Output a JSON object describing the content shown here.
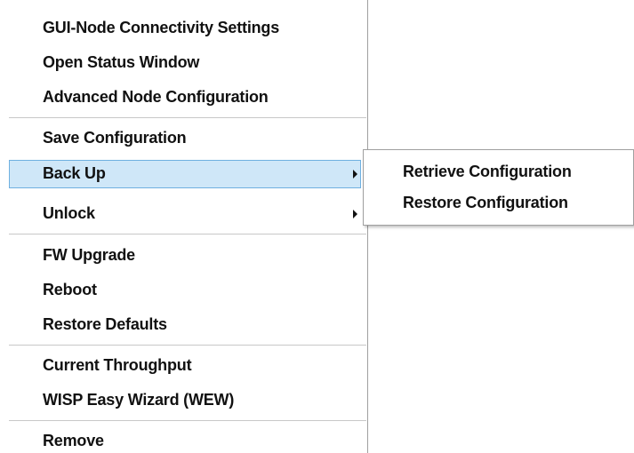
{
  "menu": {
    "items": [
      {
        "label": "GUI-Node Connectivity Settings"
      },
      {
        "label": "Open Status Window"
      },
      {
        "label": "Advanced Node Configuration"
      },
      {
        "label": "Save Configuration"
      },
      {
        "label": "Back Up",
        "has_submenu": true,
        "highlighted": true
      },
      {
        "label": "Unlock",
        "has_submenu": true
      },
      {
        "label": "FW Upgrade"
      },
      {
        "label": "Reboot"
      },
      {
        "label": "Restore Defaults"
      },
      {
        "label": "Current Throughput"
      },
      {
        "label": "WISP Easy Wizard (WEW)"
      },
      {
        "label": "Remove"
      }
    ]
  },
  "submenu": {
    "items": [
      {
        "label": "Retrieve Configuration"
      },
      {
        "label": "Restore Configuration"
      }
    ]
  },
  "colors": {
    "highlight_bg": "#cfe7f8",
    "highlight_border": "#6fb0e0",
    "separator": "#c8c8c8"
  },
  "icons": {
    "submenu_arrow": "chevron-right-icon"
  }
}
